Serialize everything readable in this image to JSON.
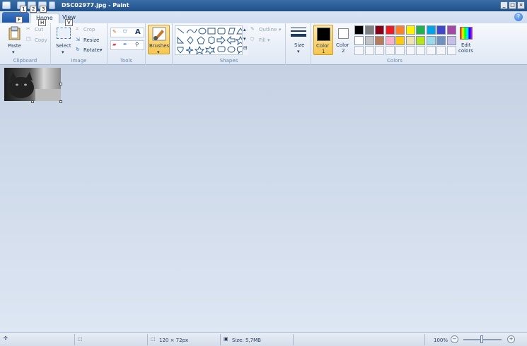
{
  "window": {
    "title": "DSC02977.jpg - Paint"
  },
  "quick_access": {
    "keytips": [
      "1",
      "2",
      "3"
    ],
    "file_keytip": "F",
    "home_keytip": "H",
    "view_keytip": "V"
  },
  "tabs": [
    {
      "label": "Home"
    },
    {
      "label": "View"
    }
  ],
  "ribbon": {
    "clipboard": {
      "paste": "Paste",
      "cut": "Cut",
      "copy": "Copy",
      "group": "Clipboard"
    },
    "image": {
      "select": "Select",
      "crop": "Crop",
      "resize": "Resize",
      "rotate": "Rotate",
      "group": "Image"
    },
    "tools": {
      "group": "Tools"
    },
    "brushes": {
      "label": "Brushes"
    },
    "shapes": {
      "outline": "Outline",
      "fill": "Fill",
      "group": "Shapes"
    },
    "size": {
      "label": "Size"
    },
    "colors": {
      "color1": "Color",
      "color1_num": "1",
      "color2": "Color",
      "color2_num": "2",
      "edit": "Edit",
      "edit2": "colors",
      "group": "Colors",
      "palette_row1": [
        "#000000",
        "#7f7f7f",
        "#880015",
        "#ed1c24",
        "#ff7f27",
        "#fff200",
        "#22b14c",
        "#00a2e8",
        "#3f48cc",
        "#a349a4"
      ],
      "palette_row2": [
        "#ffffff",
        "#c3c3c3",
        "#b97a57",
        "#ffaec9",
        "#ffc90e",
        "#efe4b0",
        "#b5e61d",
        "#99d9ea",
        "#7092be",
        "#c8bfe7"
      ]
    }
  },
  "status": {
    "dimensions": "120 × 72px",
    "size": "Size: 5,7MB",
    "zoom": "100%"
  }
}
